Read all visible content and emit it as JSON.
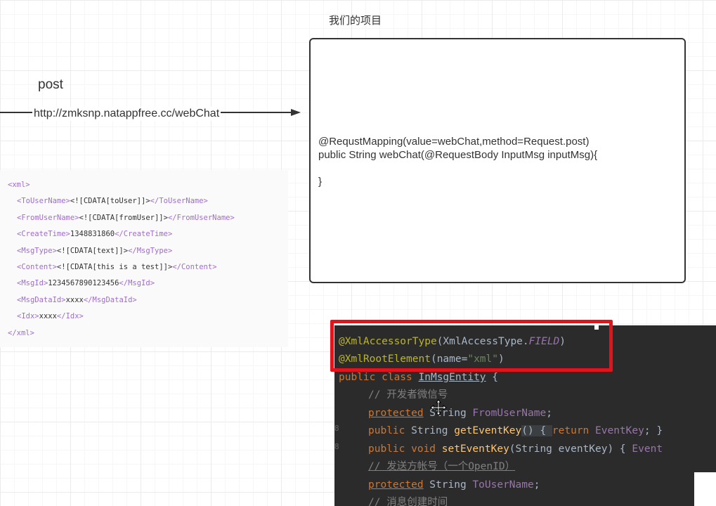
{
  "diagram": {
    "project_title": "我们的项目",
    "post_label": "post",
    "url_label": "http://zmksnp.natappfree.cc/webChat",
    "project_box_code": [
      "@RequstMapping(value=webChat,method=Request.post)",
      "public String webChat(@RequestBody InputMsg inputMsg){",
      "",
      "}"
    ]
  },
  "xml_sample": {
    "open_root": "<xml>",
    "fields": [
      {
        "tag": "ToUserName",
        "value": "<![CDATA[toUser]]>"
      },
      {
        "tag": "FromUserName",
        "value": "<![CDATA[fromUser]]>"
      },
      {
        "tag": "CreateTime",
        "value": "1348831860"
      },
      {
        "tag": "MsgType",
        "value": "<![CDATA[text]]>"
      },
      {
        "tag": "Content",
        "value": "<![CDATA[this is a test]]>"
      },
      {
        "tag": "MsgId",
        "value": "1234567890123456"
      },
      {
        "tag": "MsgDataId",
        "value": "xxxx"
      },
      {
        "tag": "Idx",
        "value": "xxxx"
      }
    ],
    "close_root": "</xml>"
  },
  "ide_code": {
    "ann1": "@XmlAccessorType",
    "ann1_arg_cls": "XmlAccessType.",
    "ann1_arg_field": "FIELD",
    "ann2": "@XmlRootElement",
    "ann2_arg_name": "name=",
    "ann2_arg_value": "\"xml\"",
    "line3_kw": "public class ",
    "line3_cls": "InMsgEntity",
    "line3_brace": " {",
    "line4_comment": "// 开发者微信号",
    "line5_kw": "protected",
    "line5_type": " String ",
    "line5_field": "FromUserName",
    "line5_semi": ";",
    "line6_kw": "public ",
    "line6_type": "String ",
    "line6_fn": "getEventKey",
    "line6_body": "() { ",
    "line6_ret": "return ",
    "line6_field": "EventKey",
    "line6_end": "; }",
    "line7_kw": "public void ",
    "line7_fn": "setEventKey",
    "line7_args": "(String eventKey) { ",
    "line7_field": "Event",
    "line8_comment": "// 发送方帐号（一个OpenID）",
    "line9_kw": "protected",
    "line9_type": " String ",
    "line9_field": "ToUserName",
    "line9_semi": ";",
    "line10_comment": "// 消息创建时间",
    "gutter_mark": "8"
  },
  "colors": {
    "highlight_border": "#e8111a",
    "ide_background": "#2b2b2b",
    "xml_tag": "#a06dcc"
  }
}
